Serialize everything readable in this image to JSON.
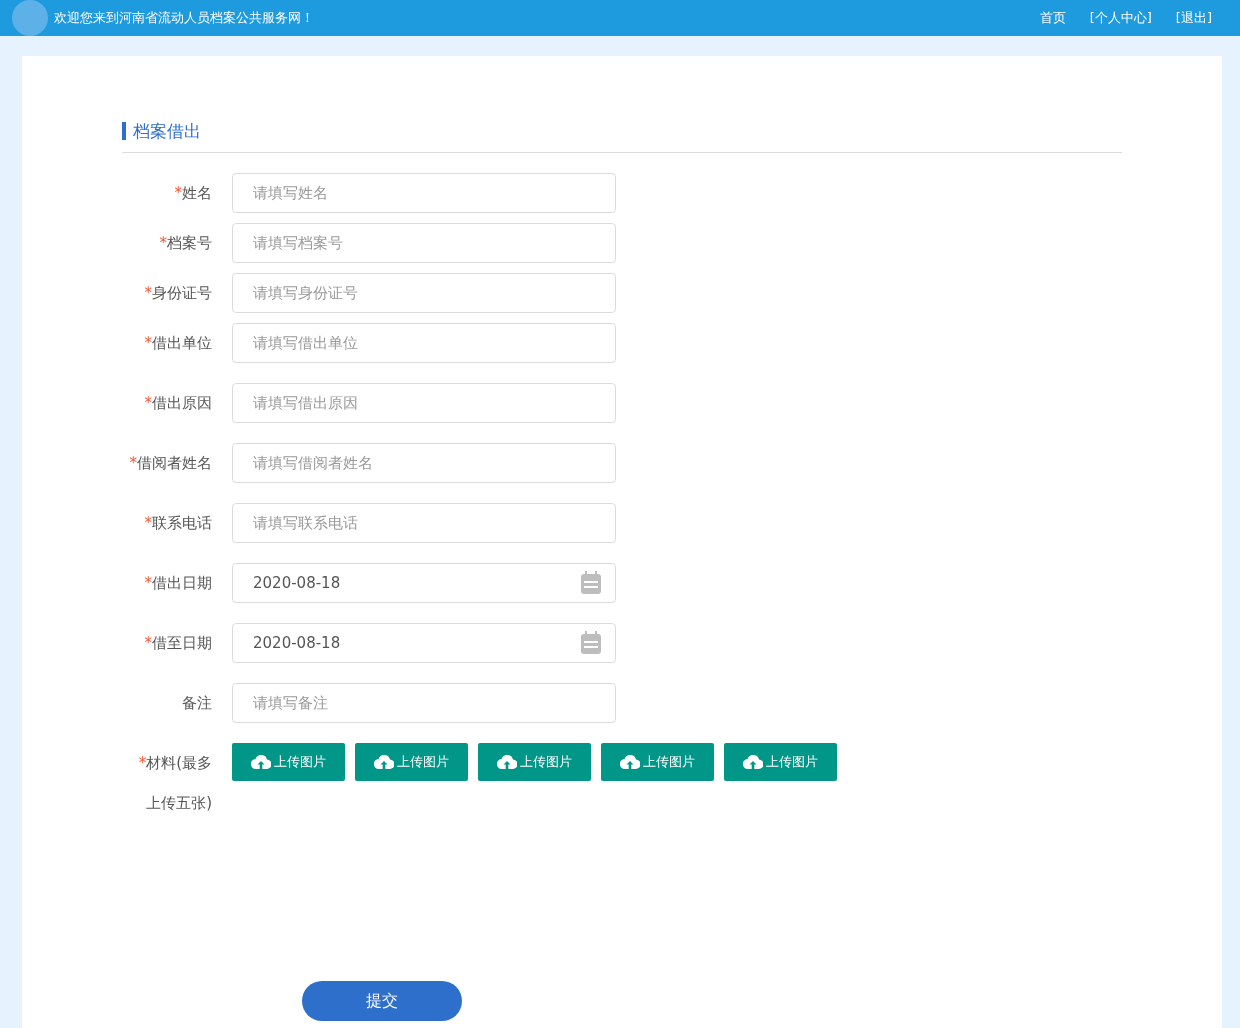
{
  "header": {
    "welcome": "欢迎您来到河南省流动人员档案公共服务网！",
    "links": [
      "首页",
      "[个人中心]",
      "[退出]"
    ]
  },
  "section_title": "档案借出",
  "fields": [
    {
      "label": "姓名",
      "required_mark": "*",
      "kind": "text",
      "placeholder": "请填写姓名"
    },
    {
      "label": "档案号",
      "required_mark": "*",
      "kind": "text",
      "placeholder": "请填写档案号"
    },
    {
      "label": "身份证号",
      "required_mark": "*",
      "kind": "text",
      "placeholder": "请填写身份证号"
    },
    {
      "label": "借出单位",
      "required_mark": "*",
      "kind": "text",
      "placeholder": "请填写借出单位"
    },
    {
      "label": "借出原因",
      "required_mark": "*",
      "kind": "text",
      "placeholder": "请填写借出原因"
    },
    {
      "label": "借阅者姓名",
      "required_mark": "*",
      "kind": "text",
      "placeholder": "请填写借阅者姓名"
    },
    {
      "label": "联系电话",
      "required_mark": "*",
      "kind": "text",
      "placeholder": "请填写联系电话"
    },
    {
      "label": "借出日期",
      "required_mark": "*",
      "kind": "date",
      "value": "2020-08-18"
    },
    {
      "label": "借至日期",
      "required_mark": "*",
      "kind": "date",
      "value": "2020-08-18"
    },
    {
      "label": "备注",
      "kind": "text",
      "placeholder": "请填写备注"
    }
  ],
  "upload": {
    "label": "材料(最多上传五张)",
    "required_mark": "*",
    "buttons": [
      "上传图片",
      "上传图片",
      "上传图片",
      "上传图片",
      "上传图片"
    ]
  },
  "submit": "提交"
}
